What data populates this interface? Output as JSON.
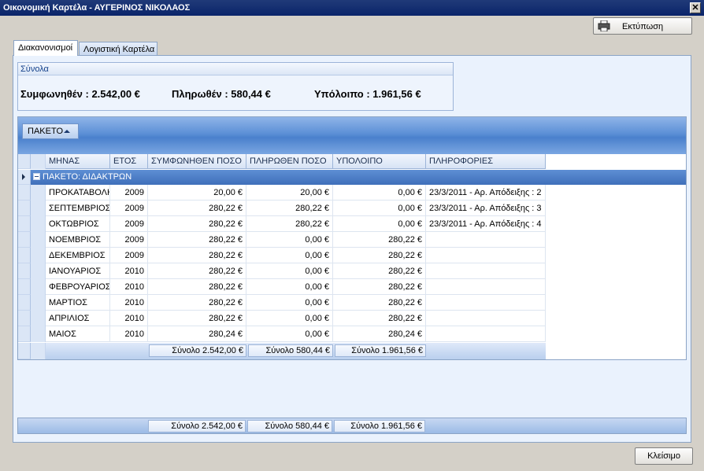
{
  "window": {
    "title": "Οικονομική Καρτέλα - ΑΥΓΕΡΙΝΟΣ ΝΙΚΟΛΑΟΣ",
    "close_glyph": "✕"
  },
  "toolbar": {
    "print_label": "Εκτύπωση",
    "print_icon": "printer-icon"
  },
  "tabs": [
    {
      "label": "Διακανονισμοί",
      "active": true
    },
    {
      "label": "Λογιστική Καρτέλα",
      "active": false
    }
  ],
  "totals": {
    "header": "Σύνολα",
    "agreed": "Συμφωνηθέν : 2.542,00 €",
    "paid": "Πληρωθέν : 580,44 €",
    "balance": "Υπόλοιπο : 1.961,56 €"
  },
  "grid": {
    "group_chip": "ΠΑΚΕΤΟ",
    "columns": [
      "ΜΗΝΑΣ",
      "ΕΤΟΣ",
      "ΣΥΜΦΩΝΗΘΕΝ ΠΟΣΟ",
      "ΠΛΗΡΩΘΕΝ ΠΟΣΟ",
      "ΥΠΟΛΟΙΠΟ",
      "ΠΛΗΡΟΦΟΡΙΕΣ"
    ],
    "group_row": "ΠΑΚΕΤΟ: ΔΙΔΑΚΤΡΩΝ",
    "rows": [
      [
        "ΠΡΟΚΑΤΑΒΟΛΗ",
        "2009",
        "20,00 €",
        "20,00 €",
        "0,00 €",
        "23/3/2011 - Αρ. Απόδειξης : 2"
      ],
      [
        "ΣΕΠΤΕΜΒΡΙΟΣ",
        "2009",
        "280,22 €",
        "280,22 €",
        "0,00 €",
        "23/3/2011 - Αρ. Απόδειξης : 3"
      ],
      [
        "ΟΚΤΩΒΡΙΟΣ",
        "2009",
        "280,22 €",
        "280,22 €",
        "0,00 €",
        "23/3/2011 - Αρ. Απόδειξης : 4"
      ],
      [
        "ΝΟΕΜΒΡΙΟΣ",
        "2009",
        "280,22 €",
        "0,00 €",
        "280,22 €",
        ""
      ],
      [
        "ΔΕΚΕΜΒΡΙΟΣ",
        "2009",
        "280,22 €",
        "0,00 €",
        "280,22 €",
        ""
      ],
      [
        "ΙΑΝΟΥΑΡΙΟΣ",
        "2010",
        "280,22 €",
        "0,00 €",
        "280,22 €",
        ""
      ],
      [
        "ΦΕΒΡΟΥΑΡΙΟΣ",
        "2010",
        "280,22 €",
        "0,00 €",
        "280,22 €",
        ""
      ],
      [
        "ΜΑΡΤΙΟΣ",
        "2010",
        "280,22 €",
        "0,00 €",
        "280,22 €",
        ""
      ],
      [
        "ΑΠΡΙΛΙΟΣ",
        "2010",
        "280,22 €",
        "0,00 €",
        "280,22 €",
        ""
      ],
      [
        "ΜΑΙΟΣ",
        "2010",
        "280,24 €",
        "0,00 €",
        "280,24 €",
        ""
      ]
    ],
    "group_footer": [
      "Σύνολο 2.542,00 €",
      "Σύνολο 580,44 €",
      "Σύνολο 1.961,56 €"
    ],
    "grand_footer": [
      "Σύνολο 2.542,00 €",
      "Σύνολο 580,44 €",
      "Σύνολο 1.961,56 €"
    ]
  },
  "dialog": {
    "close_label": "Κλείσιμο"
  }
}
